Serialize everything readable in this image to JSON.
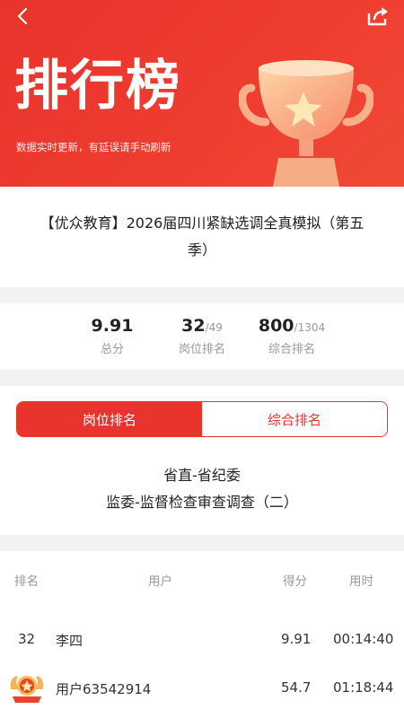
{
  "header": {
    "title": "排行榜",
    "subtitle": "数据实时更新，有延误请手动刷新"
  },
  "exam": {
    "title": "【优众教育】2026届四川紧缺选调全真模拟（第五季）"
  },
  "stats": {
    "score": "9.91",
    "score_label": "总分",
    "position_rank": "32",
    "position_total": "/49",
    "position_label": "岗位排名",
    "overall_rank": "800",
    "overall_total": "/1304",
    "overall_label": "综合排名"
  },
  "tabs": {
    "position": "岗位排名",
    "overall": "综合排名",
    "active": "position"
  },
  "position_info": {
    "line1": "省直-省纪委",
    "line2": "监委-监督检查审查调查（二）"
  },
  "table": {
    "headers": {
      "rank": "排名",
      "user": "用户",
      "score": "得分",
      "time": "用时"
    },
    "rows": [
      {
        "rank": "32",
        "user": "李四",
        "score": "9.91",
        "time": "00:14:40"
      },
      {
        "rank": "",
        "user": "用户63542914",
        "score": "54.7",
        "time": "01:18:44"
      }
    ]
  },
  "colors": {
    "accent": "#e8342c",
    "background": "#f2f2f2"
  }
}
